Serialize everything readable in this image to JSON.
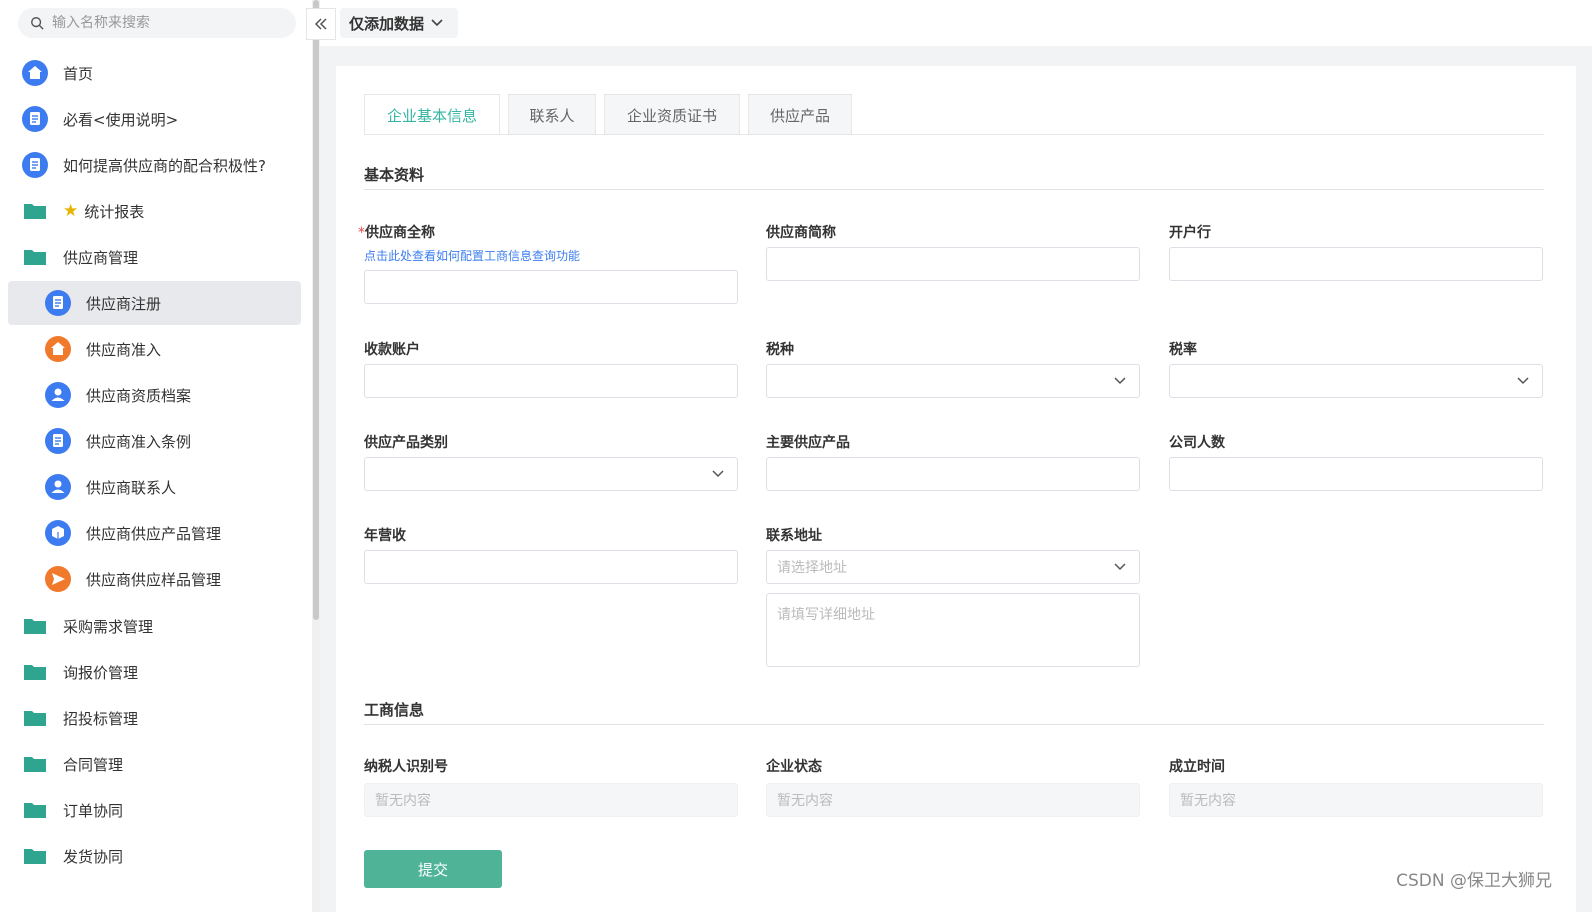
{
  "sidebar": {
    "search_placeholder": "输入名称来搜索",
    "items": [
      {
        "label": "首页",
        "icon": "home-icon"
      },
      {
        "label": "必看<使用说明>",
        "icon": "doc-icon"
      },
      {
        "label": "如何提高供应商的配合积极性?",
        "icon": "doc-icon"
      },
      {
        "label": "统计报表",
        "icon": "folder-star-icon"
      },
      {
        "label": "供应商管理",
        "icon": "folder-icon"
      },
      {
        "label": "供应商注册",
        "icon": "doc-icon",
        "active": true
      },
      {
        "label": "供应商准入",
        "icon": "home-icon"
      },
      {
        "label": "供应商资质档案",
        "icon": "user-icon"
      },
      {
        "label": "供应商准入条例",
        "icon": "doc-icon"
      },
      {
        "label": "供应商联系人",
        "icon": "user-icon"
      },
      {
        "label": "供应商供应产品管理",
        "icon": "box-icon"
      },
      {
        "label": "供应商供应样品管理",
        "icon": "send-icon"
      },
      {
        "label": "采购需求管理",
        "icon": "folder-icon"
      },
      {
        "label": "询报价管理",
        "icon": "folder-icon"
      },
      {
        "label": "招投标管理",
        "icon": "folder-icon"
      },
      {
        "label": "合同管理",
        "icon": "folder-icon"
      },
      {
        "label": "订单协同",
        "icon": "folder-icon"
      },
      {
        "label": "发货协同",
        "icon": "folder-icon"
      }
    ]
  },
  "topbar": {
    "mode_label": "仅添加数据"
  },
  "tabs": [
    "企业基本信息",
    "联系人",
    "企业资质证书",
    "供应产品"
  ],
  "form": {
    "section_basic": "基本资料",
    "full_name_label": "供应商全称",
    "full_name_required": "*",
    "help_link": "点击此处查看如何配置工商信息查询功能",
    "short_name_label": "供应商简称",
    "bank_label": "开户行",
    "account_label": "收款账户",
    "tax_type_label": "税种",
    "tax_rate_label": "税率",
    "product_category_label": "供应产品类别",
    "main_product_label": "主要供应产品",
    "employees_label": "公司人数",
    "revenue_label": "年营收",
    "address_label": "联系地址",
    "address_select_placeholder": "请选择地址",
    "address_detail_placeholder": "请填写详细地址",
    "section_business": "工商信息",
    "tax_id_label": "纳税人识别号",
    "status_label": "企业状态",
    "founded_label": "成立时间",
    "empty_value": "暂无内容",
    "submit_label": "提交"
  },
  "watermark": "CSDN @保卫大狮兄",
  "colors": {
    "accent": "#36b5a2",
    "icon_blue": "#3d7bf0",
    "icon_orange": "#f0792b",
    "folder": "#2fa58f"
  }
}
